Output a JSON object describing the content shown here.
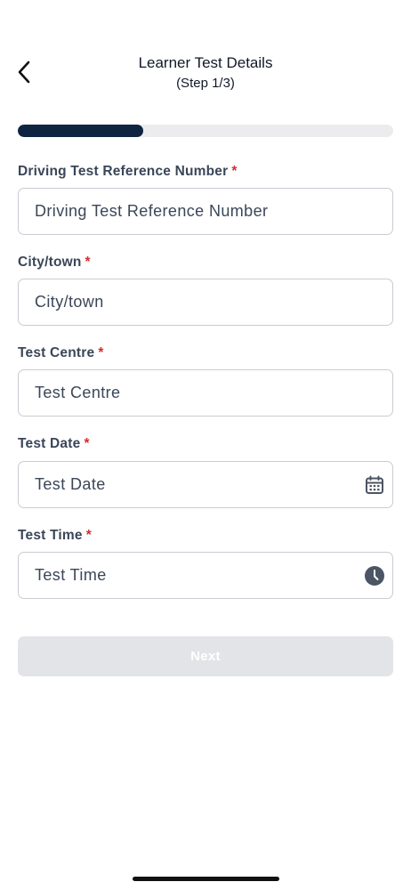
{
  "header": {
    "title": "Learner Test Details",
    "step": "(Step 1/3)"
  },
  "progress": {
    "fraction": 0.333
  },
  "form": {
    "fields": [
      {
        "label": "Driving Test Reference Number",
        "required_mark": "*",
        "placeholder": "Driving Test Reference Number",
        "value": ""
      },
      {
        "label": "City/town",
        "required_mark": "*",
        "placeholder": "City/town",
        "value": ""
      },
      {
        "label": "Test Centre",
        "required_mark": "*",
        "placeholder": "Test Centre",
        "value": ""
      },
      {
        "label": "Test Date",
        "required_mark": "*",
        "placeholder": "Test Date",
        "value": "",
        "icon": "calendar-icon"
      },
      {
        "label": "Test Time",
        "required_mark": "*",
        "placeholder": "Test Time",
        "value": "",
        "icon": "clock-icon"
      }
    ],
    "next_label": "Next"
  },
  "colors": {
    "progress_fill": "#0e2440",
    "progress_track": "#ececee",
    "required": "#d32f2f",
    "button_disabled": "#e2e4e8",
    "icon": "#4b5563"
  }
}
